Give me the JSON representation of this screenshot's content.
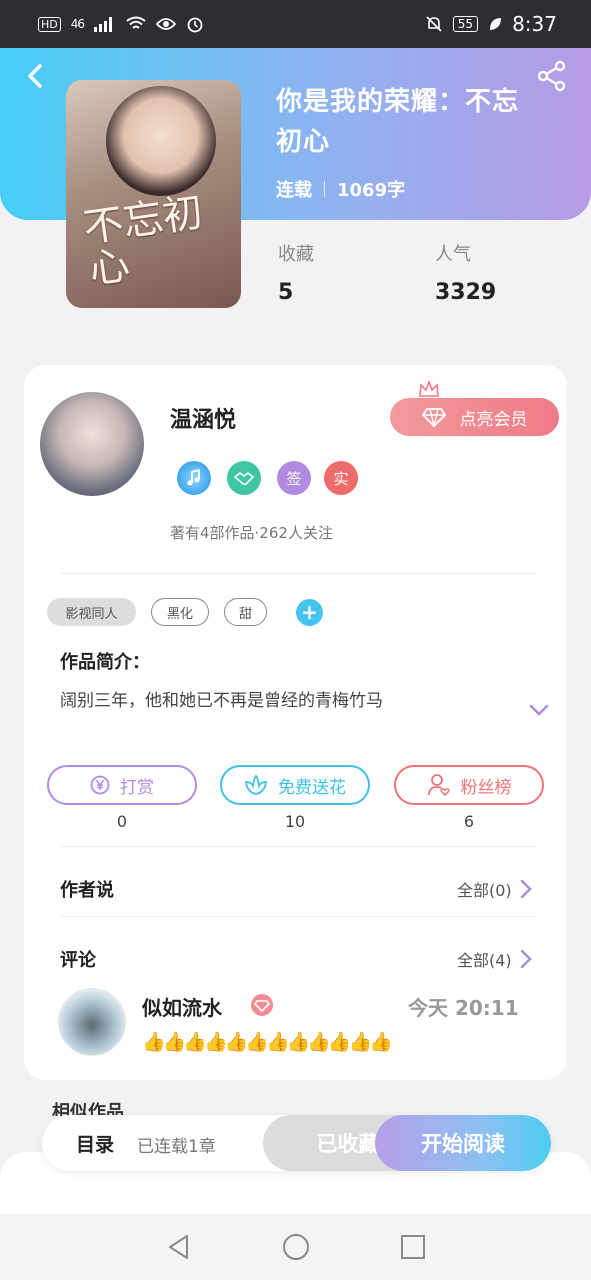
{
  "status_bar": {
    "hd": "HD",
    "network": "46",
    "battery": "55",
    "time": "8:37"
  },
  "book": {
    "title": "你是我的荣耀：不忘初心",
    "status": "连载",
    "word_count": "1069字",
    "cover_text": "不忘初心",
    "favorites_label": "收藏",
    "favorites_value": "5",
    "popularity_label": "人气",
    "popularity_value": "3329"
  },
  "author": {
    "name": "温涵悦",
    "vip_button": "点亮会员",
    "badges": [
      {
        "icon": "music-note-badge-icon",
        "color": "#3ea6f0"
      },
      {
        "icon": "handshake-badge-icon",
        "color": "#3ec6a5"
      },
      {
        "label": "签",
        "color": "#b18be0"
      },
      {
        "label": "实",
        "color": "#ef6b6b"
      }
    ],
    "stats": "著有4部作品·262人关注"
  },
  "tags": [
    "影视同人",
    "黑化",
    "甜"
  ],
  "synopsis": {
    "heading": "作品简介：",
    "text": "阔别三年，他和她已不再是曾经的青梅竹马"
  },
  "actions": [
    {
      "label": "打赏",
      "count": "0",
      "color": "#b38be2",
      "icon": "yen-coin-icon"
    },
    {
      "label": "免费送花",
      "count": "10",
      "color": "#3fc0e8",
      "icon": "flower-icon"
    },
    {
      "label": "粉丝榜",
      "count": "6",
      "color": "#ee7476",
      "icon": "fan-user-icon"
    }
  ],
  "author_says": {
    "heading": "作者说",
    "see_all": "全部(0)"
  },
  "comments": {
    "heading": "评论",
    "see_all": "全部(4)",
    "items": [
      {
        "user": "似如流水",
        "time": "今天 20:11",
        "text": "👍👍👍👍👍👍👍👍👍👍👍👍"
      }
    ]
  },
  "similar": {
    "heading": "相似作品"
  },
  "bottom_bar": {
    "toc": "目录",
    "chapters": "已连载1章",
    "favorited": "已收藏",
    "start_reading": "开始阅读"
  },
  "colors": {
    "hero_gradient_start": "#45cef4",
    "hero_gradient_end": "#b69be6",
    "vip_pink": "#ee7a87",
    "accent_cyan": "#47c3ef",
    "accent_purple": "#b79fe8"
  }
}
